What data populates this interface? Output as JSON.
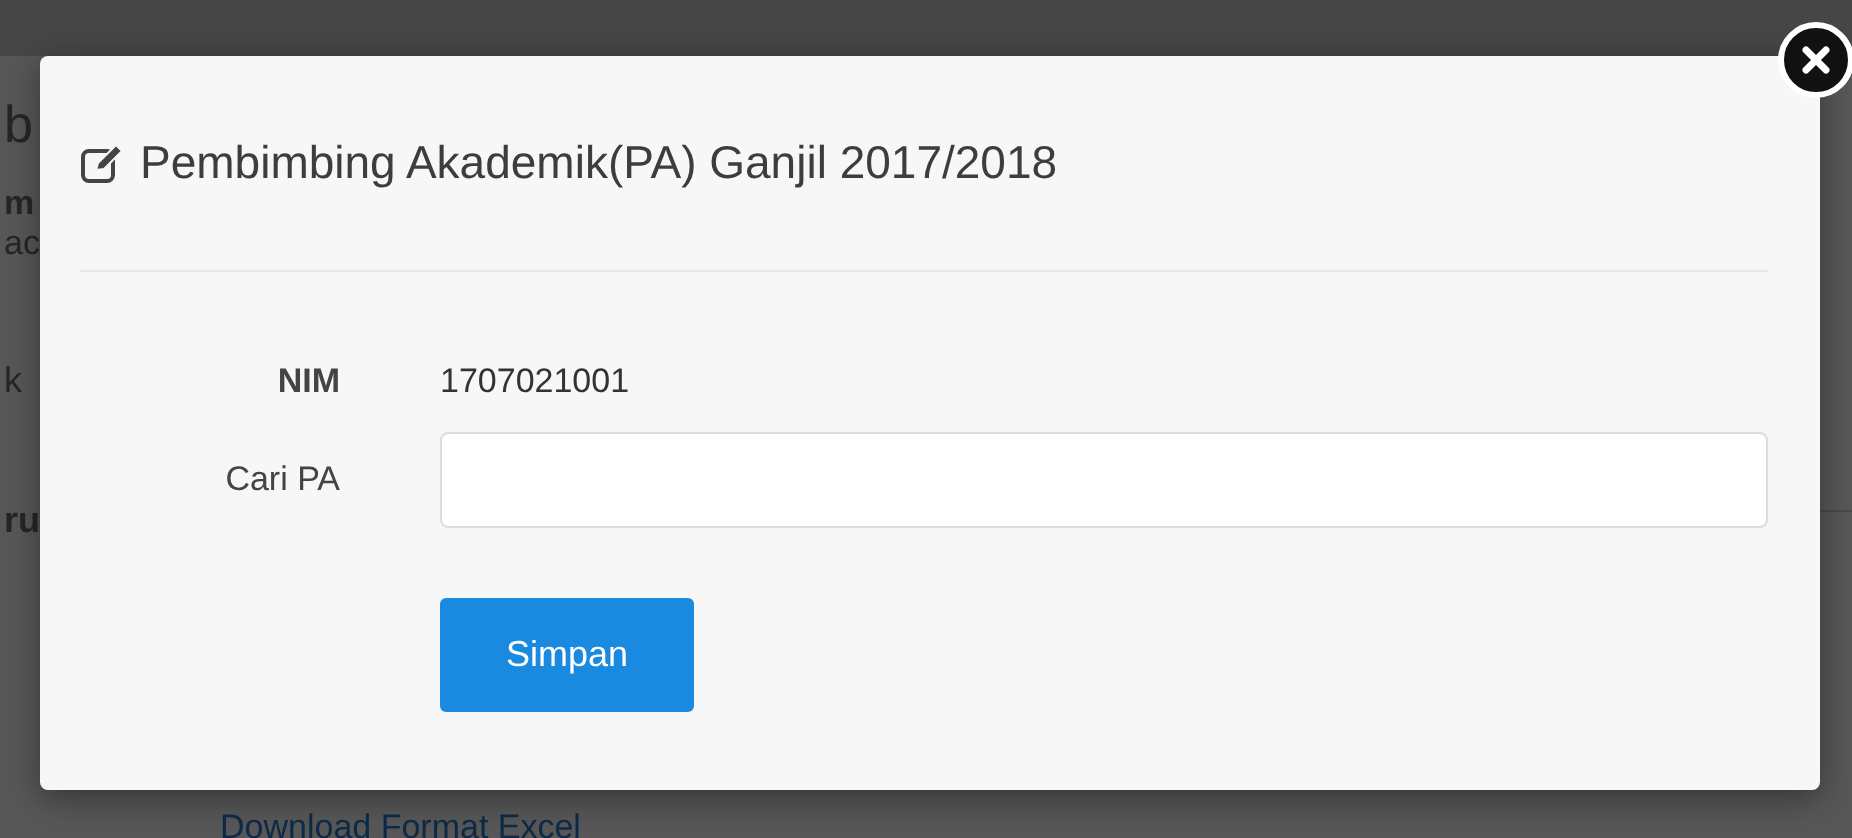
{
  "backdrop": {
    "fragments": [
      "b",
      "m",
      "ac",
      "k",
      "ru"
    ],
    "link": "Download Format Excel"
  },
  "modal": {
    "title": "Pembimbing Akademik(PA) Ganjil 2017/2018",
    "fields": [
      {
        "kind": "static",
        "label": "NIM",
        "value": "1707021001"
      },
      {
        "kind": "input",
        "label": "Cari PA"
      }
    ],
    "submit": "Simpan"
  }
}
